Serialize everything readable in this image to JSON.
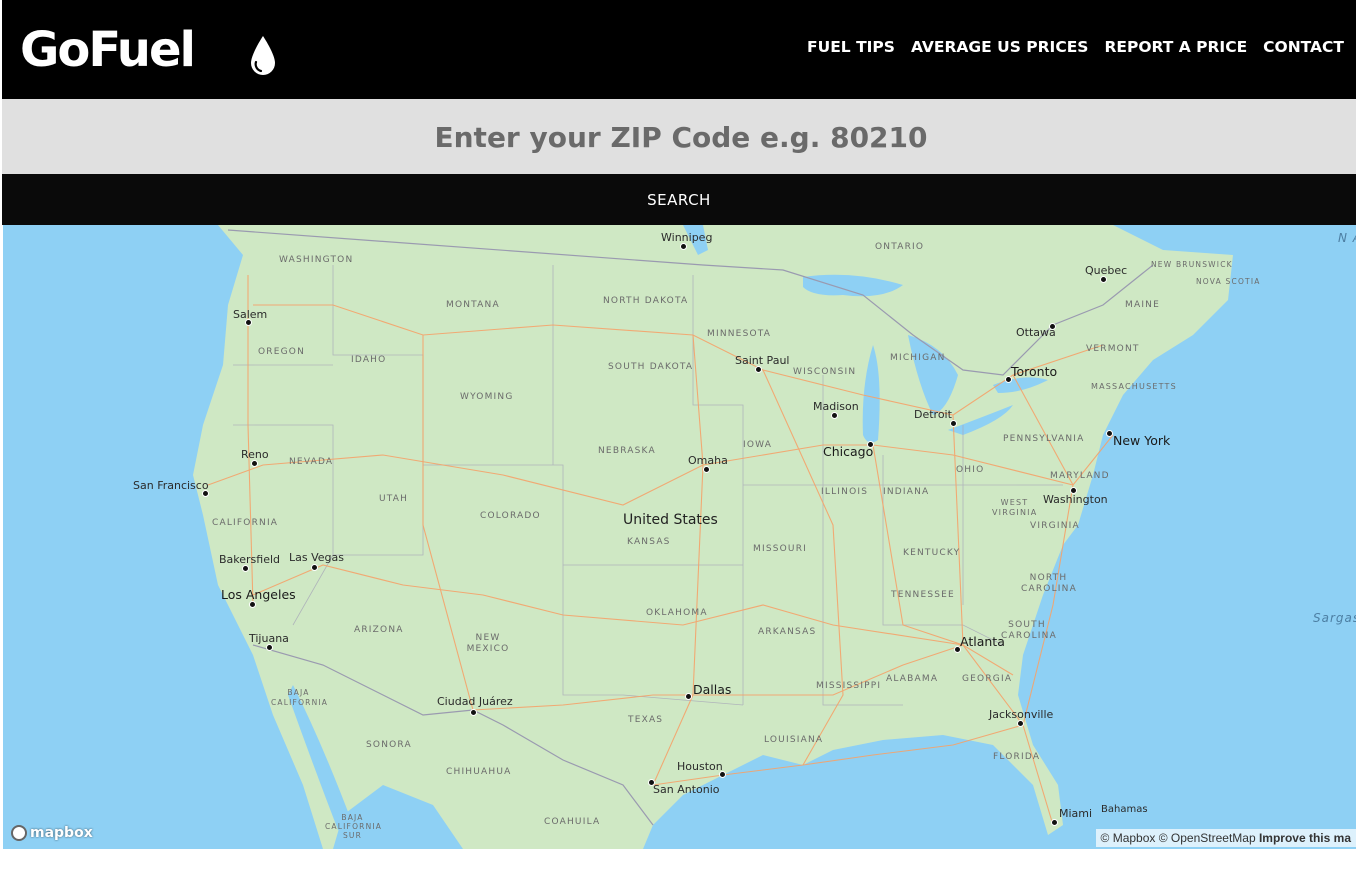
{
  "header": {
    "logo_text": "GoFuel",
    "logo_icon": "droplet-icon",
    "nav": [
      "FUEL TIPS",
      "AVERAGE US PRICES",
      "REPORT A PRICE",
      "CONTACT"
    ]
  },
  "search": {
    "placeholder": "Enter your ZIP Code e.g. 80210",
    "button_label": "SEARCH"
  },
  "map": {
    "country_label": "United States",
    "cities": [
      "Winnipeg",
      "Quebec",
      "Salem",
      "Ottawa",
      "Saint Paul",
      "Toronto",
      "Madison",
      "Detroit",
      "New York",
      "Chicago",
      "Reno",
      "Omaha",
      "Washington",
      "San Francisco",
      "Bakersfield",
      "Las Vegas",
      "Los Angeles",
      "Atlanta",
      "Tijuana",
      "Dallas",
      "Ciudad Juárez",
      "Jacksonville",
      "Houston",
      "San Antonio",
      "Miami",
      "Bahamas"
    ],
    "states": [
      "WASHINGTON",
      "ONTARIO",
      "NEW BRUNSWICK",
      "NOVA SCOTIA",
      "MONTANA",
      "NORTH DAKOTA",
      "MAINE",
      "MINNESOTA",
      "OREGON",
      "IDAHO",
      "SOUTH DAKOTA",
      "WISCONSIN",
      "MICHIGAN",
      "VERMONT",
      "WYOMING",
      "MASSACHUSETTS",
      "IOWA",
      "NEBRASKA",
      "PENNSYLVANIA",
      "NEVADA",
      "OHIO",
      "MARYLAND",
      "UTAH",
      "COLORADO",
      "ILLINOIS",
      "INDIANA",
      "WEST VIRGINIA",
      "CALIFORNIA",
      "KANSAS",
      "VIRGINIA",
      "MISSOURI",
      "KENTUCKY",
      "TENNESSEE",
      "NORTH CAROLINA",
      "OKLAHOMA",
      "ARIZONA",
      "ARKANSAS",
      "SOUTH CAROLINA",
      "NEW MEXICO",
      "MISSISSIPPI",
      "ALABAMA",
      "GEORGIA",
      "BAJA CALIFORNIA",
      "TEXAS",
      "LOUISIANA",
      "SONORA",
      "CHIHUAHUA",
      "FLORIDA",
      "COAHUILA",
      "BAJA CALIFORNIA SUR"
    ],
    "ocean_labels": [
      "N At O",
      "Sargas Sea"
    ],
    "colors": {
      "land": "#cfe8c4",
      "water": "#8ed0f4",
      "roads": "#f5a36b",
      "borders": "#9a9ab0"
    }
  },
  "footer": {
    "mapbox_logo": "mapbox",
    "attribution": "© Mapbox © OpenStreetMap",
    "improve_link": "Improve this ma"
  }
}
